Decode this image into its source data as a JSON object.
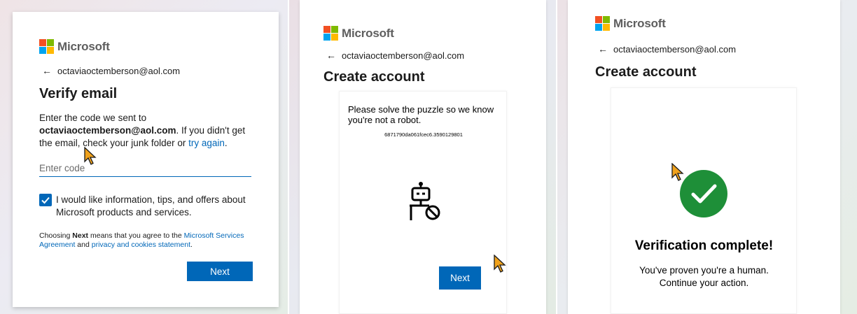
{
  "brand": {
    "logo_text": "Microsoft",
    "colors": {
      "red": "#f25022",
      "green": "#7fba00",
      "blue": "#00a4ef",
      "yellow": "#ffb900",
      "accent": "#0067b8",
      "success": "#1e8f38"
    }
  },
  "panel_verify": {
    "back_arrow": "←",
    "email": "octaviaoctemberson@aol.com",
    "title": "Verify email",
    "desc_prefix": "Enter the code we sent to",
    "desc_email": "octaviaoctemberson@aol.com",
    "desc_middle": ". If you didn't get the email, check your junk folder or",
    "try_again": "try again",
    "desc_end": ".",
    "code_placeholder": "Enter code",
    "code_value": "",
    "checkbox_checked": true,
    "checkbox_label": "I would like information, tips, and offers about Microsoft products and services.",
    "terms_prefix": "Choosing",
    "terms_next": "Next",
    "terms_middle": "means that you agree to the",
    "terms_link1": "Microsoft Services Agreement",
    "terms_and": "and",
    "terms_link2": "privacy and cookies statement",
    "terms_end": ".",
    "next_label": "Next"
  },
  "panel_puzzle": {
    "back_arrow": "←",
    "email": "octaviaoctemberson@aol.com",
    "title": "Create account",
    "puzzle_text": "Please solve the puzzle so we know you're not a robot.",
    "puzzle_id": "6871790da061fcec6.3590129801",
    "robot_icon": "robot-blocked-icon",
    "next_label": "Next"
  },
  "panel_complete": {
    "back_arrow": "←",
    "email": "octaviaoctemberson@aol.com",
    "title": "Create account",
    "success_icon": "checkmark-circle-icon",
    "verify_title": "Verification complete!",
    "verify_line1": "You've proven you're a human.",
    "verify_line2": "Continue your action."
  }
}
